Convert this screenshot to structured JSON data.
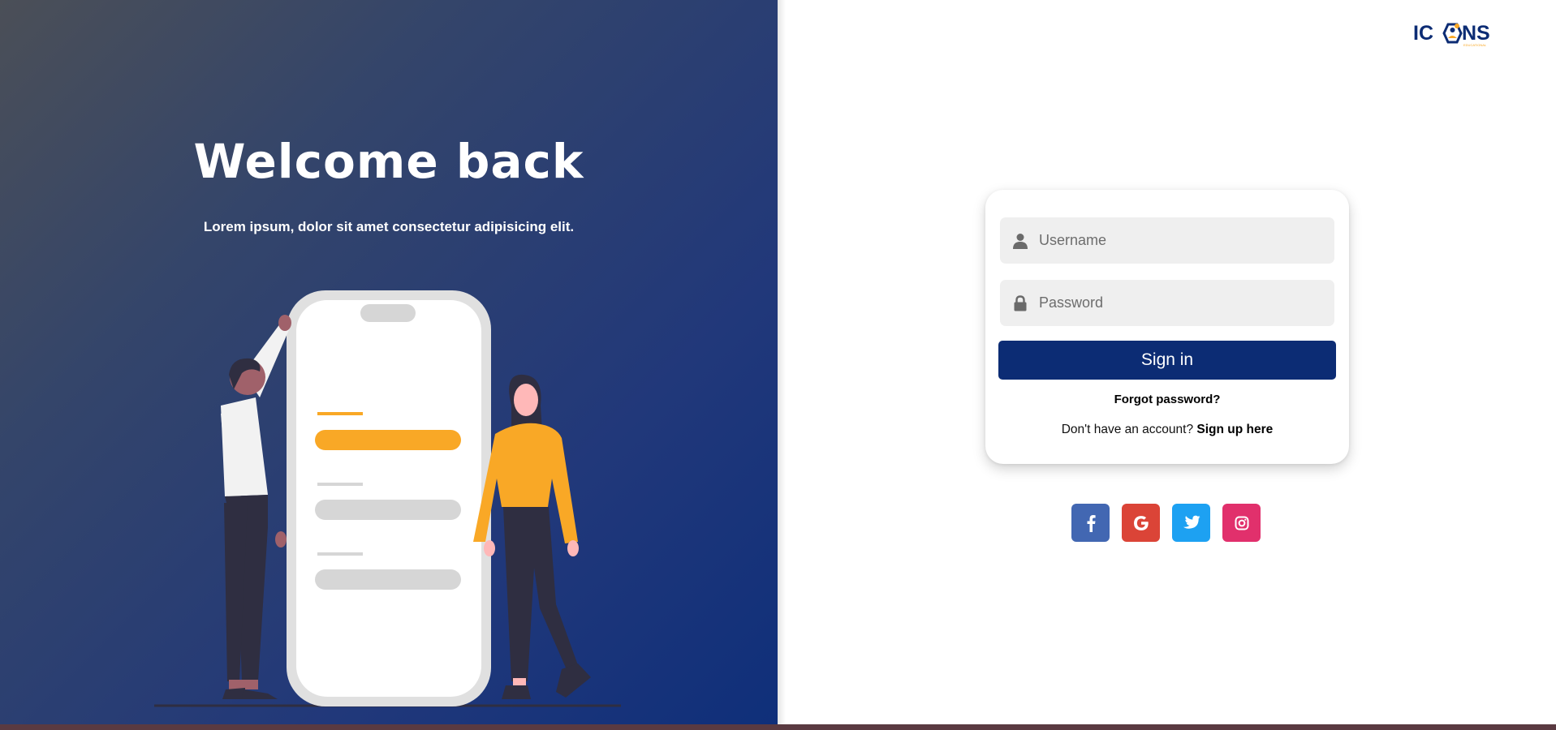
{
  "hero": {
    "title": "Welcome back",
    "subtitle": "Lorem ipsum, dolor sit amet consectetur adipisicing elit."
  },
  "brand": {
    "logo_text": "ICONS",
    "logo_tagline": "EDUCATIONAL",
    "logo_icon": "hexagon-person-icon"
  },
  "login": {
    "username_placeholder": "Username",
    "password_placeholder": "Password",
    "username_icon": "user-icon",
    "password_icon": "lock-icon",
    "sign_in_label": "Sign in",
    "forgot_password": "Forgot password?",
    "no_account_text": "Don't have an account?",
    "sign_up_link": "Sign up here"
  },
  "social": [
    {
      "name": "facebook-icon",
      "color": "#4267b2"
    },
    {
      "name": "google-icon",
      "color": "#db4437"
    },
    {
      "name": "twitter-icon",
      "color": "#1da1f2"
    },
    {
      "name": "instagram-icon",
      "color": "#e1306c"
    }
  ],
  "colors": {
    "primary": "#0c2c74",
    "accent": "#f9a826",
    "field_bg": "#efefef"
  }
}
